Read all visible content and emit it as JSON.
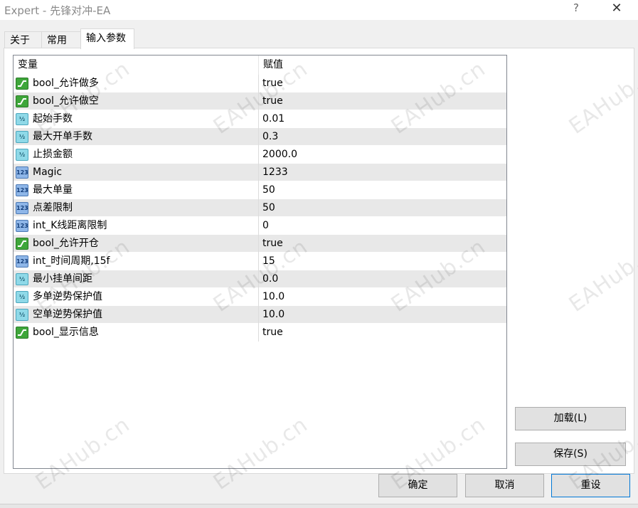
{
  "window": {
    "title": "Expert - 先锋对冲-EA",
    "help_glyph": "?",
    "close_glyph": "✕"
  },
  "tabs": [
    {
      "label": "关于"
    },
    {
      "label": "常用"
    },
    {
      "label": "输入参数"
    }
  ],
  "grid": {
    "col_variable": "变量",
    "col_value": "赋值",
    "rows": [
      {
        "type": "bool",
        "icon_text": "",
        "name": "bool_允许做多",
        "value": "true"
      },
      {
        "type": "bool",
        "icon_text": "",
        "name": "bool_允许做空",
        "value": "true"
      },
      {
        "type": "double",
        "icon_text": "½",
        "name": "起始手数",
        "value": "0.01"
      },
      {
        "type": "double",
        "icon_text": "½",
        "name": "最大开单手数",
        "value": "0.3"
      },
      {
        "type": "double",
        "icon_text": "½",
        "name": "止损金额",
        "value": "2000.0"
      },
      {
        "type": "int",
        "icon_text": "123",
        "name": "Magic",
        "value": "1233"
      },
      {
        "type": "int",
        "icon_text": "123",
        "name": "最大单量",
        "value": "50"
      },
      {
        "type": "int",
        "icon_text": "123",
        "name": "点差限制",
        "value": "50"
      },
      {
        "type": "int",
        "icon_text": "123",
        "name": "int_K线距离限制",
        "value": "0"
      },
      {
        "type": "bool",
        "icon_text": "",
        "name": "bool_允许开仓",
        "value": "true"
      },
      {
        "type": "int",
        "icon_text": "123",
        "name": "int_时间周期,15f",
        "value": "15"
      },
      {
        "type": "double",
        "icon_text": "½",
        "name": "最小挂单间距",
        "value": "0.0"
      },
      {
        "type": "double",
        "icon_text": "½",
        "name": "多单逆势保护值",
        "value": "10.0"
      },
      {
        "type": "double",
        "icon_text": "½",
        "name": "空单逆势保护值",
        "value": "10.0"
      },
      {
        "type": "bool",
        "icon_text": "",
        "name": "bool_显示信息",
        "value": "true"
      }
    ]
  },
  "side_buttons": {
    "load": "加载(L)",
    "save": "保存(S)"
  },
  "footer_buttons": {
    "ok": "确定",
    "cancel": "取消",
    "reset": "重设"
  },
  "watermark": "EAHub.cn"
}
